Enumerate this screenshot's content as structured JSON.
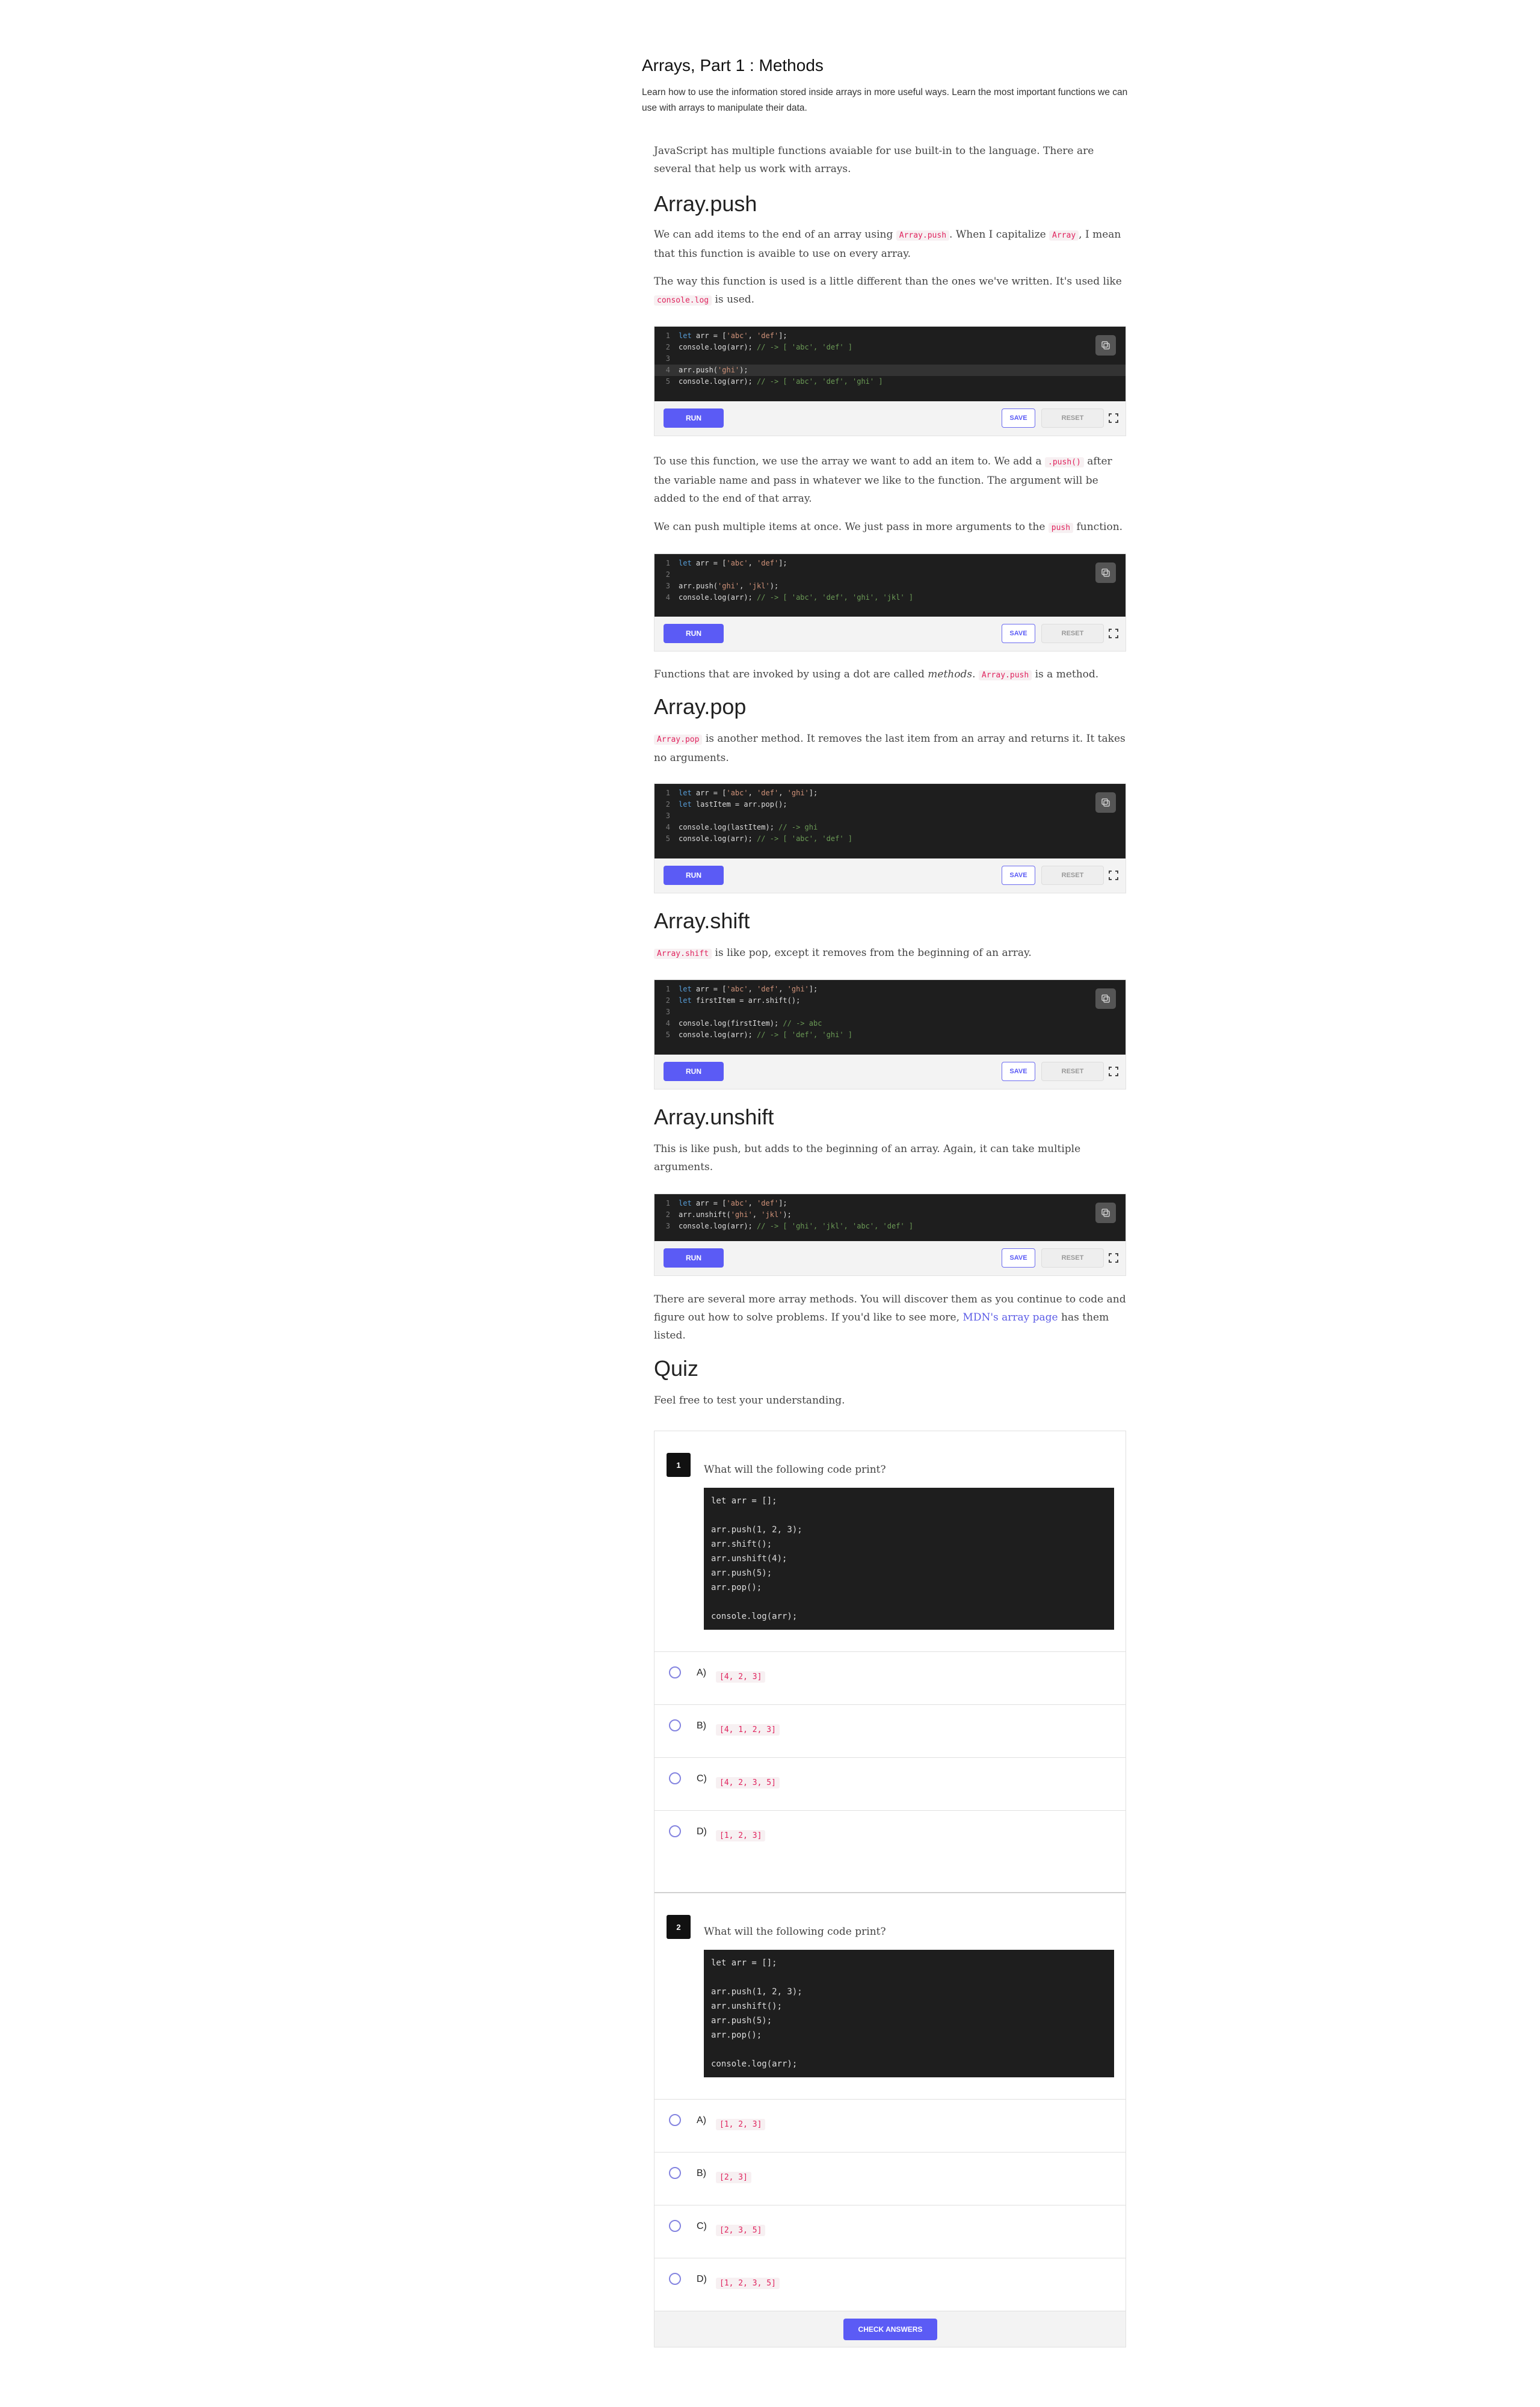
{
  "header": {
    "title": "Arrays, Part 1 : Methods",
    "subtitle": "Learn how to use the information stored inside arrays in more useful ways. Learn the most important functions we can use with arrays to manipulate their data."
  },
  "labels": {
    "run": "RUN",
    "save": "SAVE",
    "reset": "RESET",
    "check": "CHECK ANSWERS"
  },
  "article": {
    "intro": "JavaScript has multiple functions avaiable for use built-in to the language. There are several that help us work with arrays.",
    "push": {
      "heading": "Array.push",
      "p1_a": "We can add items to the end of an array using ",
      "p1_code1": "Array.push",
      "p1_b": ". When I capitalize ",
      "p1_code2": "Array",
      "p1_c": ", I mean that this function is avaible to use on every array.",
      "p2_a": "The way this function is used is a little different than the ones we've written. It's used like ",
      "p2_code": "console.log",
      "p2_b": " is used.",
      "p3_a": "To use this function, we use the array we want to add an item to. We add a ",
      "p3_code": ".push()",
      "p3_b": " after the variable name and pass in whatever we like to the function. The argument will be added to the end of that array.",
      "p4_a": "We can push multiple items at once. We just pass in more arguments to the ",
      "p4_code": "push",
      "p4_b": " function.",
      "p5_a": "Functions that are invoked by using a dot are called ",
      "p5_em": "methods",
      "p5_b": ". ",
      "p5_code": "Array.push",
      "p5_c": " is a method."
    },
    "pop": {
      "heading": "Array.pop",
      "p1_code": "Array.pop",
      "p1_b": " is another method. It removes the last item from an array and returns it. It takes no arguments."
    },
    "shift": {
      "heading": "Array.shift",
      "p1_code": "Array.shift",
      "p1_b": " is like pop, except it removes from the beginning of an array."
    },
    "unshift": {
      "heading": "Array.unshift",
      "p1": "This is like push, but adds to the beginning of an array. Again, it can take multiple arguments.",
      "p2_a": "There are several more array methods. You will discover them as you continue to code and figure out how to solve problems. If you'd like to see more, ",
      "p2_link": "MDN's array page",
      "p2_b": " has them listed."
    },
    "quiz": {
      "heading": "Quiz",
      "intro": "Feel free to test your understanding."
    }
  },
  "code_blocks": {
    "c1": [
      "let arr = ['abc', 'def'];",
      "console.log(arr); // -> [ 'abc', 'def' ]",
      "",
      "arr.push('ghi');",
      "console.log(arr); // -> [ 'abc', 'def', 'ghi' ]"
    ],
    "c2": [
      "let arr = ['abc', 'def'];",
      "",
      "arr.push('ghi', 'jkl');",
      "console.log(arr); // -> [ 'abc', 'def', 'ghi', 'jkl' ]"
    ],
    "c3": [
      "let arr = ['abc', 'def', 'ghi'];",
      "let lastItem = arr.pop();",
      "",
      "console.log(lastItem); // -> ghi",
      "console.log(arr); // -> [ 'abc', 'def' ]"
    ],
    "c4": [
      "let arr = ['abc', 'def', 'ghi'];",
      "let firstItem = arr.shift();",
      "",
      "console.log(firstItem); // -> abc",
      "console.log(arr); // -> [ 'def', 'ghi' ]"
    ],
    "c5": [
      "let arr = ['abc', 'def'];",
      "arr.unshift('ghi', 'jkl');",
      "console.log(arr); // -> [ 'ghi', 'jkl', 'abc', 'def' ]"
    ]
  },
  "questions": [
    {
      "number": "1",
      "text": "What will the following code print?",
      "code": "let arr = [];\n\narr.push(1, 2, 3);\narr.shift();\narr.unshift(4);\narr.push(5);\narr.pop();\n\nconsole.log(arr);",
      "options": [
        {
          "label": "A)",
          "value": "[4, 2, 3]"
        },
        {
          "label": "B)",
          "value": "[4, 1, 2, 3]"
        },
        {
          "label": "C)",
          "value": "[4, 2, 3, 5]"
        },
        {
          "label": "D)",
          "value": "[1, 2, 3]"
        }
      ]
    },
    {
      "number": "2",
      "text": "What will the following code print?",
      "code": "let arr = [];\n\narr.push(1, 2, 3);\narr.unshift();\narr.push(5);\narr.pop();\n\nconsole.log(arr);",
      "options": [
        {
          "label": "A)",
          "value": "[1, 2, 3]"
        },
        {
          "label": "B)",
          "value": "[2, 3]"
        },
        {
          "label": "C)",
          "value": "[2, 3, 5]"
        },
        {
          "label": "D)",
          "value": "[1, 2, 3, 5]"
        }
      ]
    }
  ]
}
